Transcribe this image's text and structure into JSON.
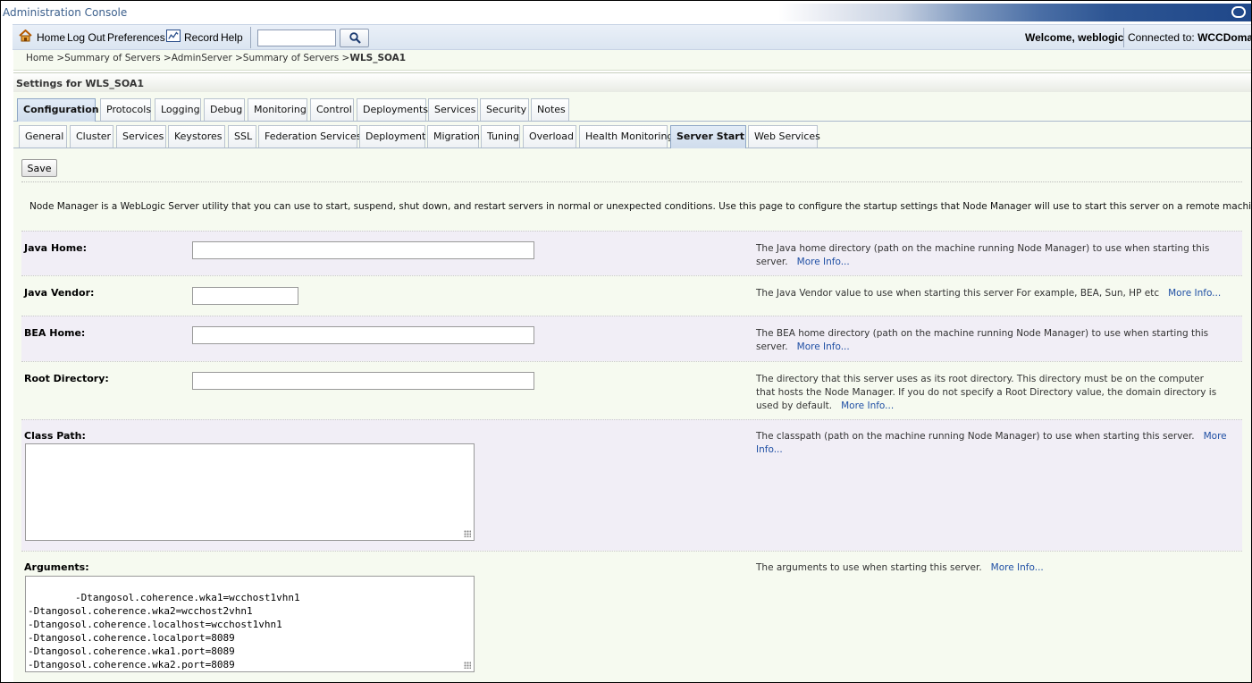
{
  "app": {
    "title": "Administration Console"
  },
  "toolbar": {
    "home": "Home",
    "logout": "Log Out",
    "preferences": "Preferences",
    "record": "Record",
    "help": "Help",
    "search_value": "",
    "welcome": "Welcome, weblogic",
    "connected_label": "Connected to:",
    "connected_value": "WCCDomain"
  },
  "breadcrumb": {
    "items": [
      "Home >",
      "Summary of Servers >",
      "AdminServer >",
      "Summary of Servers >"
    ],
    "current": "WLS_SOA1"
  },
  "settings": {
    "title": "Settings for WLS_SOA1"
  },
  "tabs_primary": [
    "Configuration",
    "Protocols",
    "Logging",
    "Debug",
    "Monitoring",
    "Control",
    "Deployments",
    "Services",
    "Security",
    "Notes"
  ],
  "tabs_secondary": [
    "General",
    "Cluster",
    "Services",
    "Keystores",
    "SSL",
    "Federation Services",
    "Deployment",
    "Migration",
    "Tuning",
    "Overload",
    "Health Monitoring",
    "Server Start",
    "Web Services"
  ],
  "active_primary": "Configuration",
  "active_secondary": "Server Start",
  "save_label": "Save",
  "intro": "Node Manager is a WebLogic Server utility that you can use to start, suspend, shut down, and restart servers in normal or unexpected conditions. Use this page to configure the startup settings that Node Manager will use to start this server on a remote machine.",
  "fields": {
    "java_home": {
      "label": "Java Home:",
      "value": "",
      "help": "The Java home directory (path on the machine running Node Manager) to use when starting this server.",
      "more": "More Info..."
    },
    "java_vendor": {
      "label": "Java Vendor:",
      "value": "",
      "help": "The Java Vendor value to use when starting this server For example, BEA, Sun, HP etc",
      "more": "More Info..."
    },
    "bea_home": {
      "label": "BEA Home:",
      "value": "",
      "help": "The BEA home directory (path on the machine running Node Manager) to use when starting this server.",
      "more": "More Info..."
    },
    "root_directory": {
      "label": "Root Directory:",
      "value": "",
      "help": "The directory that this server uses as its root directory. This directory must be on the computer that hosts the Node Manager. If you do not specify a Root Directory value, the domain directory is used by default.",
      "more": "More Info..."
    },
    "class_path": {
      "label": "Class Path:",
      "value": "",
      "help": "The classpath (path on the machine running Node Manager) to use when starting this server.",
      "more": "More Info..."
    },
    "arguments": {
      "label": "Arguments:",
      "value": "-Dtangosol.coherence.wka1=wcchost1vhn1\n-Dtangosol.coherence.wka2=wcchost2vhn1\n-Dtangosol.coherence.localhost=wcchost1vhn1\n-Dtangosol.coherence.localport=8089\n-Dtangosol.coherence.wka1.port=8089\n-Dtangosol.coherence.wka2.port=8089",
      "help": "The arguments to use when starting this server.",
      "more": "More Info..."
    }
  }
}
